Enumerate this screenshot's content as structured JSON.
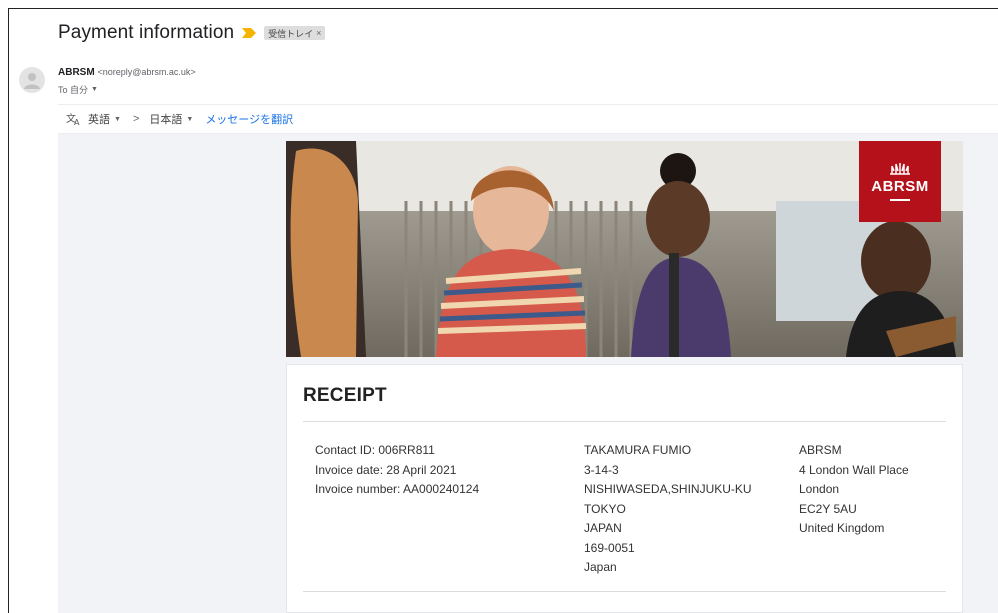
{
  "email": {
    "subject": "Payment information",
    "label_chip": "受信トレイ",
    "label_remove": "×",
    "sender_name": "ABRSM",
    "sender_address": "<noreply@abrsm.ac.uk>",
    "to_line": "To 自分"
  },
  "translate_bar": {
    "source_lang": "英語",
    "arrow": ">",
    "target_lang": "日本語",
    "translate_link": "メッセージを翻訳"
  },
  "brand": {
    "logo_text": "ABRSM",
    "accent_color": "#b4111a"
  },
  "receipt": {
    "title": "RECEIPT",
    "details": [
      "Contact ID: 006RR811",
      "Invoice date: 28 April 2021",
      "Invoice number: AA000240124"
    ],
    "customer_address": [
      "TAKAMURA FUMIO",
      "3-14-3",
      "NISHIWASEDA,SHINJUKU-KU",
      "TOKYO",
      "JAPAN",
      "169-0051",
      "Japan"
    ],
    "company_address": [
      "ABRSM",
      "4 London Wall Place",
      "London",
      "EC2Y 5AU",
      "United Kingdom"
    ]
  }
}
